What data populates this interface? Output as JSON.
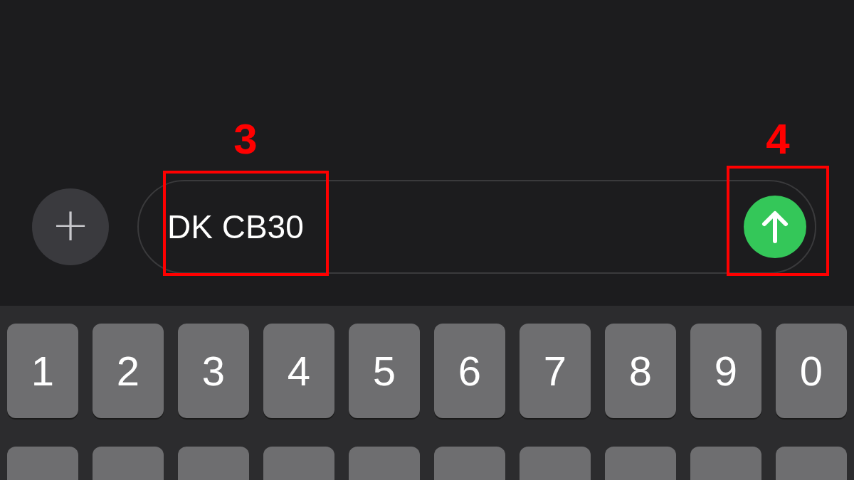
{
  "composer": {
    "attach_button": "+",
    "message_field": {
      "value": "DK CB30",
      "callout": "3"
    },
    "send_button": {
      "callout": "4"
    }
  },
  "keyboard": {
    "rows": [
      {
        "keys": [
          "1",
          "2",
          "3",
          "4",
          "5",
          "6",
          "7",
          "8",
          "9",
          "0"
        ]
      },
      {
        "keys": [
          {
            "kind": "blank"
          },
          {
            "kind": "blank"
          },
          {
            "kind": "blank"
          },
          {
            "kind": "blank"
          },
          {
            "kind": "blank"
          },
          {
            "kind": "blank"
          },
          {
            "kind": "blank"
          },
          {
            "kind": "blank"
          },
          {
            "kind": "blank"
          },
          {
            "kind": "blank"
          }
        ]
      }
    ]
  }
}
